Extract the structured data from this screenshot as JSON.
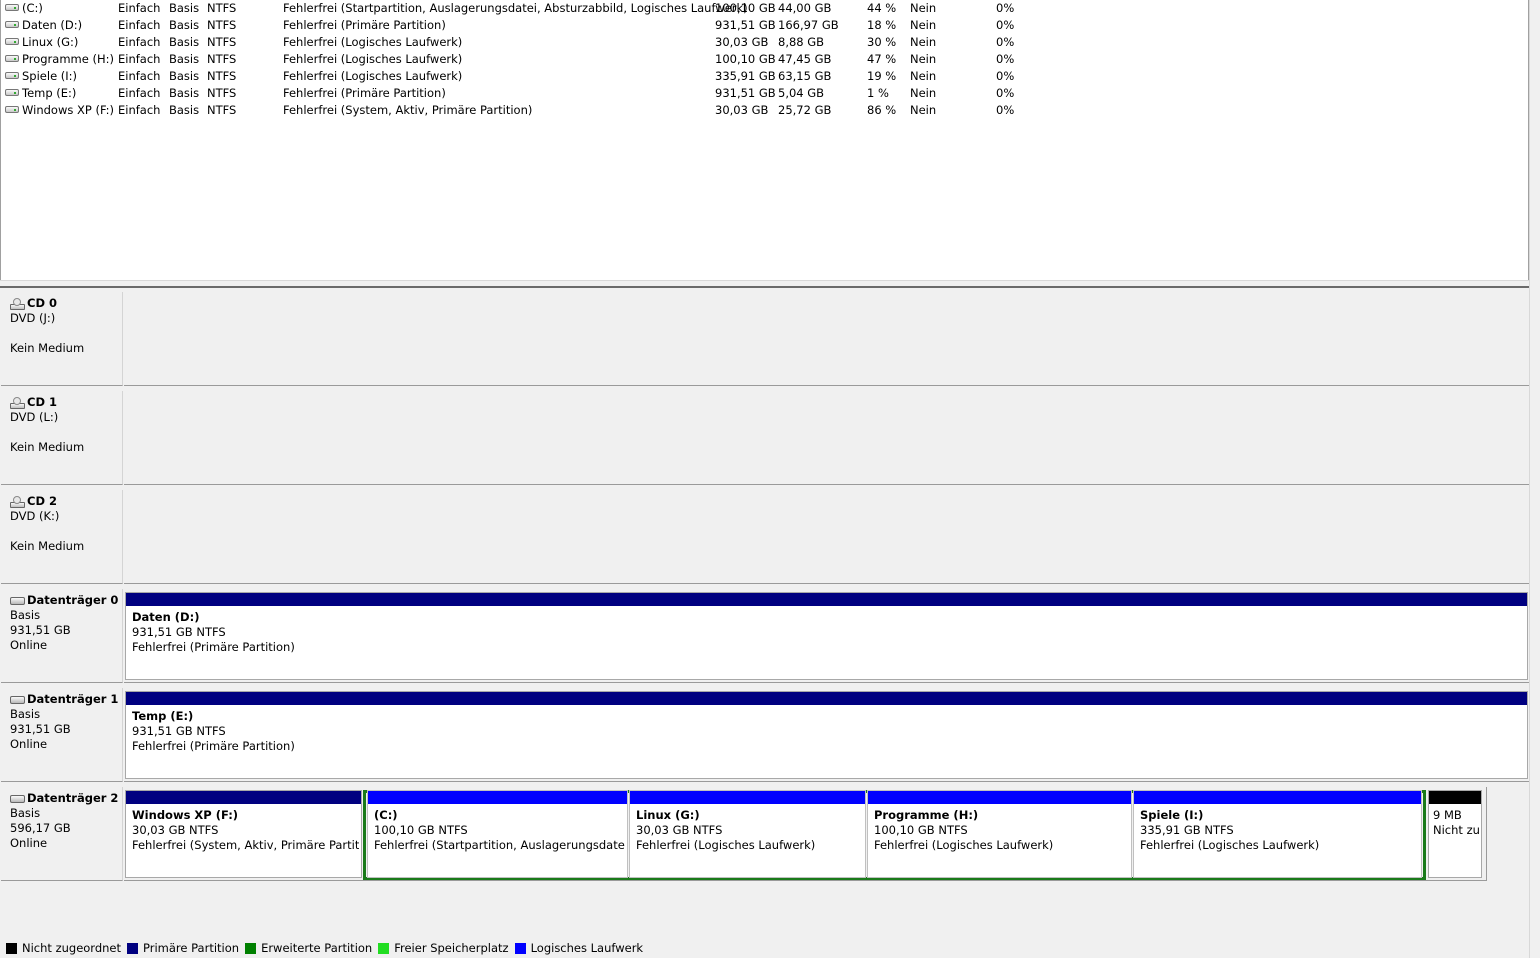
{
  "volumes": [
    {
      "name": "(C:)",
      "layout": "Einfach",
      "type": "Basis",
      "fs": "NTFS",
      "status": "Fehlerfrei (Startpartition, Auslagerungsdatei, Absturzabbild, Logisches Laufwerk)",
      "capacity": "100,10 GB",
      "free": "44,00 GB",
      "pct": "44 %",
      "fault": "Nein",
      "overhead": "0%"
    },
    {
      "name": "Daten (D:)",
      "layout": "Einfach",
      "type": "Basis",
      "fs": "NTFS",
      "status": "Fehlerfrei (Primäre Partition)",
      "capacity": "931,51 GB",
      "free": "166,97 GB",
      "pct": "18 %",
      "fault": "Nein",
      "overhead": "0%"
    },
    {
      "name": "Linux (G:)",
      "layout": "Einfach",
      "type": "Basis",
      "fs": "NTFS",
      "status": "Fehlerfrei (Logisches Laufwerk)",
      "capacity": "30,03 GB",
      "free": "8,88 GB",
      "pct": "30 %",
      "fault": "Nein",
      "overhead": "0%"
    },
    {
      "name": "Programme (H:)",
      "layout": "Einfach",
      "type": "Basis",
      "fs": "NTFS",
      "status": "Fehlerfrei (Logisches Laufwerk)",
      "capacity": "100,10 GB",
      "free": "47,45 GB",
      "pct": "47 %",
      "fault": "Nein",
      "overhead": "0%"
    },
    {
      "name": "Spiele (I:)",
      "layout": "Einfach",
      "type": "Basis",
      "fs": "NTFS",
      "status": "Fehlerfrei (Logisches Laufwerk)",
      "capacity": "335,91 GB",
      "free": "63,15 GB",
      "pct": "19 %",
      "fault": "Nein",
      "overhead": "0%"
    },
    {
      "name": "Temp (E:)",
      "layout": "Einfach",
      "type": "Basis",
      "fs": "NTFS",
      "status": "Fehlerfrei (Primäre Partition)",
      "capacity": "931,51 GB",
      "free": "5,04 GB",
      "pct": "1 %",
      "fault": "Nein",
      "overhead": "0%"
    },
    {
      "name": "Windows XP (F:)",
      "layout": "Einfach",
      "type": "Basis",
      "fs": "NTFS",
      "status": "Fehlerfrei (System, Aktiv, Primäre Partition)",
      "capacity": "30,03 GB",
      "free": "25,72 GB",
      "pct": "86 %",
      "fault": "Nein",
      "overhead": "0%"
    }
  ],
  "cdroms": [
    {
      "title": "CD 0",
      "drive": "DVD (J:)",
      "media": "Kein Medium"
    },
    {
      "title": "CD 1",
      "drive": "DVD (L:)",
      "media": "Kein Medium"
    },
    {
      "title": "CD 2",
      "drive": "DVD (K:)",
      "media": "Kein Medium"
    }
  ],
  "disks": [
    {
      "title": "Datenträger 0",
      "type": "Basis",
      "size": "931,51 GB",
      "state": "Online",
      "partitions": [
        {
          "name": "Daten  (D:)",
          "size": "931,51 GB NTFS",
          "status": "Fehlerfrei (Primäre Partition)",
          "kind": "primary"
        }
      ]
    },
    {
      "title": "Datenträger 1",
      "type": "Basis",
      "size": "931,51 GB",
      "state": "Online",
      "partitions": [
        {
          "name": "Temp  (E:)",
          "size": "931,51 GB NTFS",
          "status": "Fehlerfrei (Primäre Partition)",
          "kind": "primary"
        }
      ]
    },
    {
      "title": "Datenträger 2",
      "type": "Basis",
      "size": "596,17 GB",
      "state": "Online",
      "partitions": [
        {
          "name": "Windows XP  (F:)",
          "size": "30,03 GB NTFS",
          "status": "Fehlerfrei (System, Aktiv, Primäre Partition",
          "kind": "primary"
        },
        {
          "name": " (C:)",
          "size": "100,10 GB NTFS",
          "status": "Fehlerfrei (Startpartition, Auslagerungsdatei, Ab",
          "kind": "logical"
        },
        {
          "name": "Linux  (G:)",
          "size": "30,03 GB NTFS",
          "status": "Fehlerfrei (Logisches Laufwerk)",
          "kind": "logical"
        },
        {
          "name": "Programme  (H:)",
          "size": "100,10 GB NTFS",
          "status": "Fehlerfrei (Logisches Laufwerk)",
          "kind": "logical"
        },
        {
          "name": "Spiele  (I:)",
          "size": "335,91 GB NTFS",
          "status": "Fehlerfrei (Logisches Laufwerk)",
          "kind": "logical"
        },
        {
          "name": "",
          "size": "9 MB",
          "status": "Nicht zu",
          "kind": "unallocated"
        }
      ]
    }
  ],
  "legend": [
    {
      "label": "Nicht zugeordnet",
      "color": "#000000"
    },
    {
      "label": "Primäre Partition",
      "color": "#000080"
    },
    {
      "label": "Erweiterte Partition",
      "color": "#008000"
    },
    {
      "label": "Freier Speicherplatz",
      "color": "#22dd22"
    },
    {
      "label": "Logisches Laufwerk",
      "color": "#0000ff"
    }
  ],
  "colors": {
    "primary": "#000080",
    "logical": "#0000ff",
    "unallocated": "#000000",
    "extended": "#1a7a1a"
  }
}
